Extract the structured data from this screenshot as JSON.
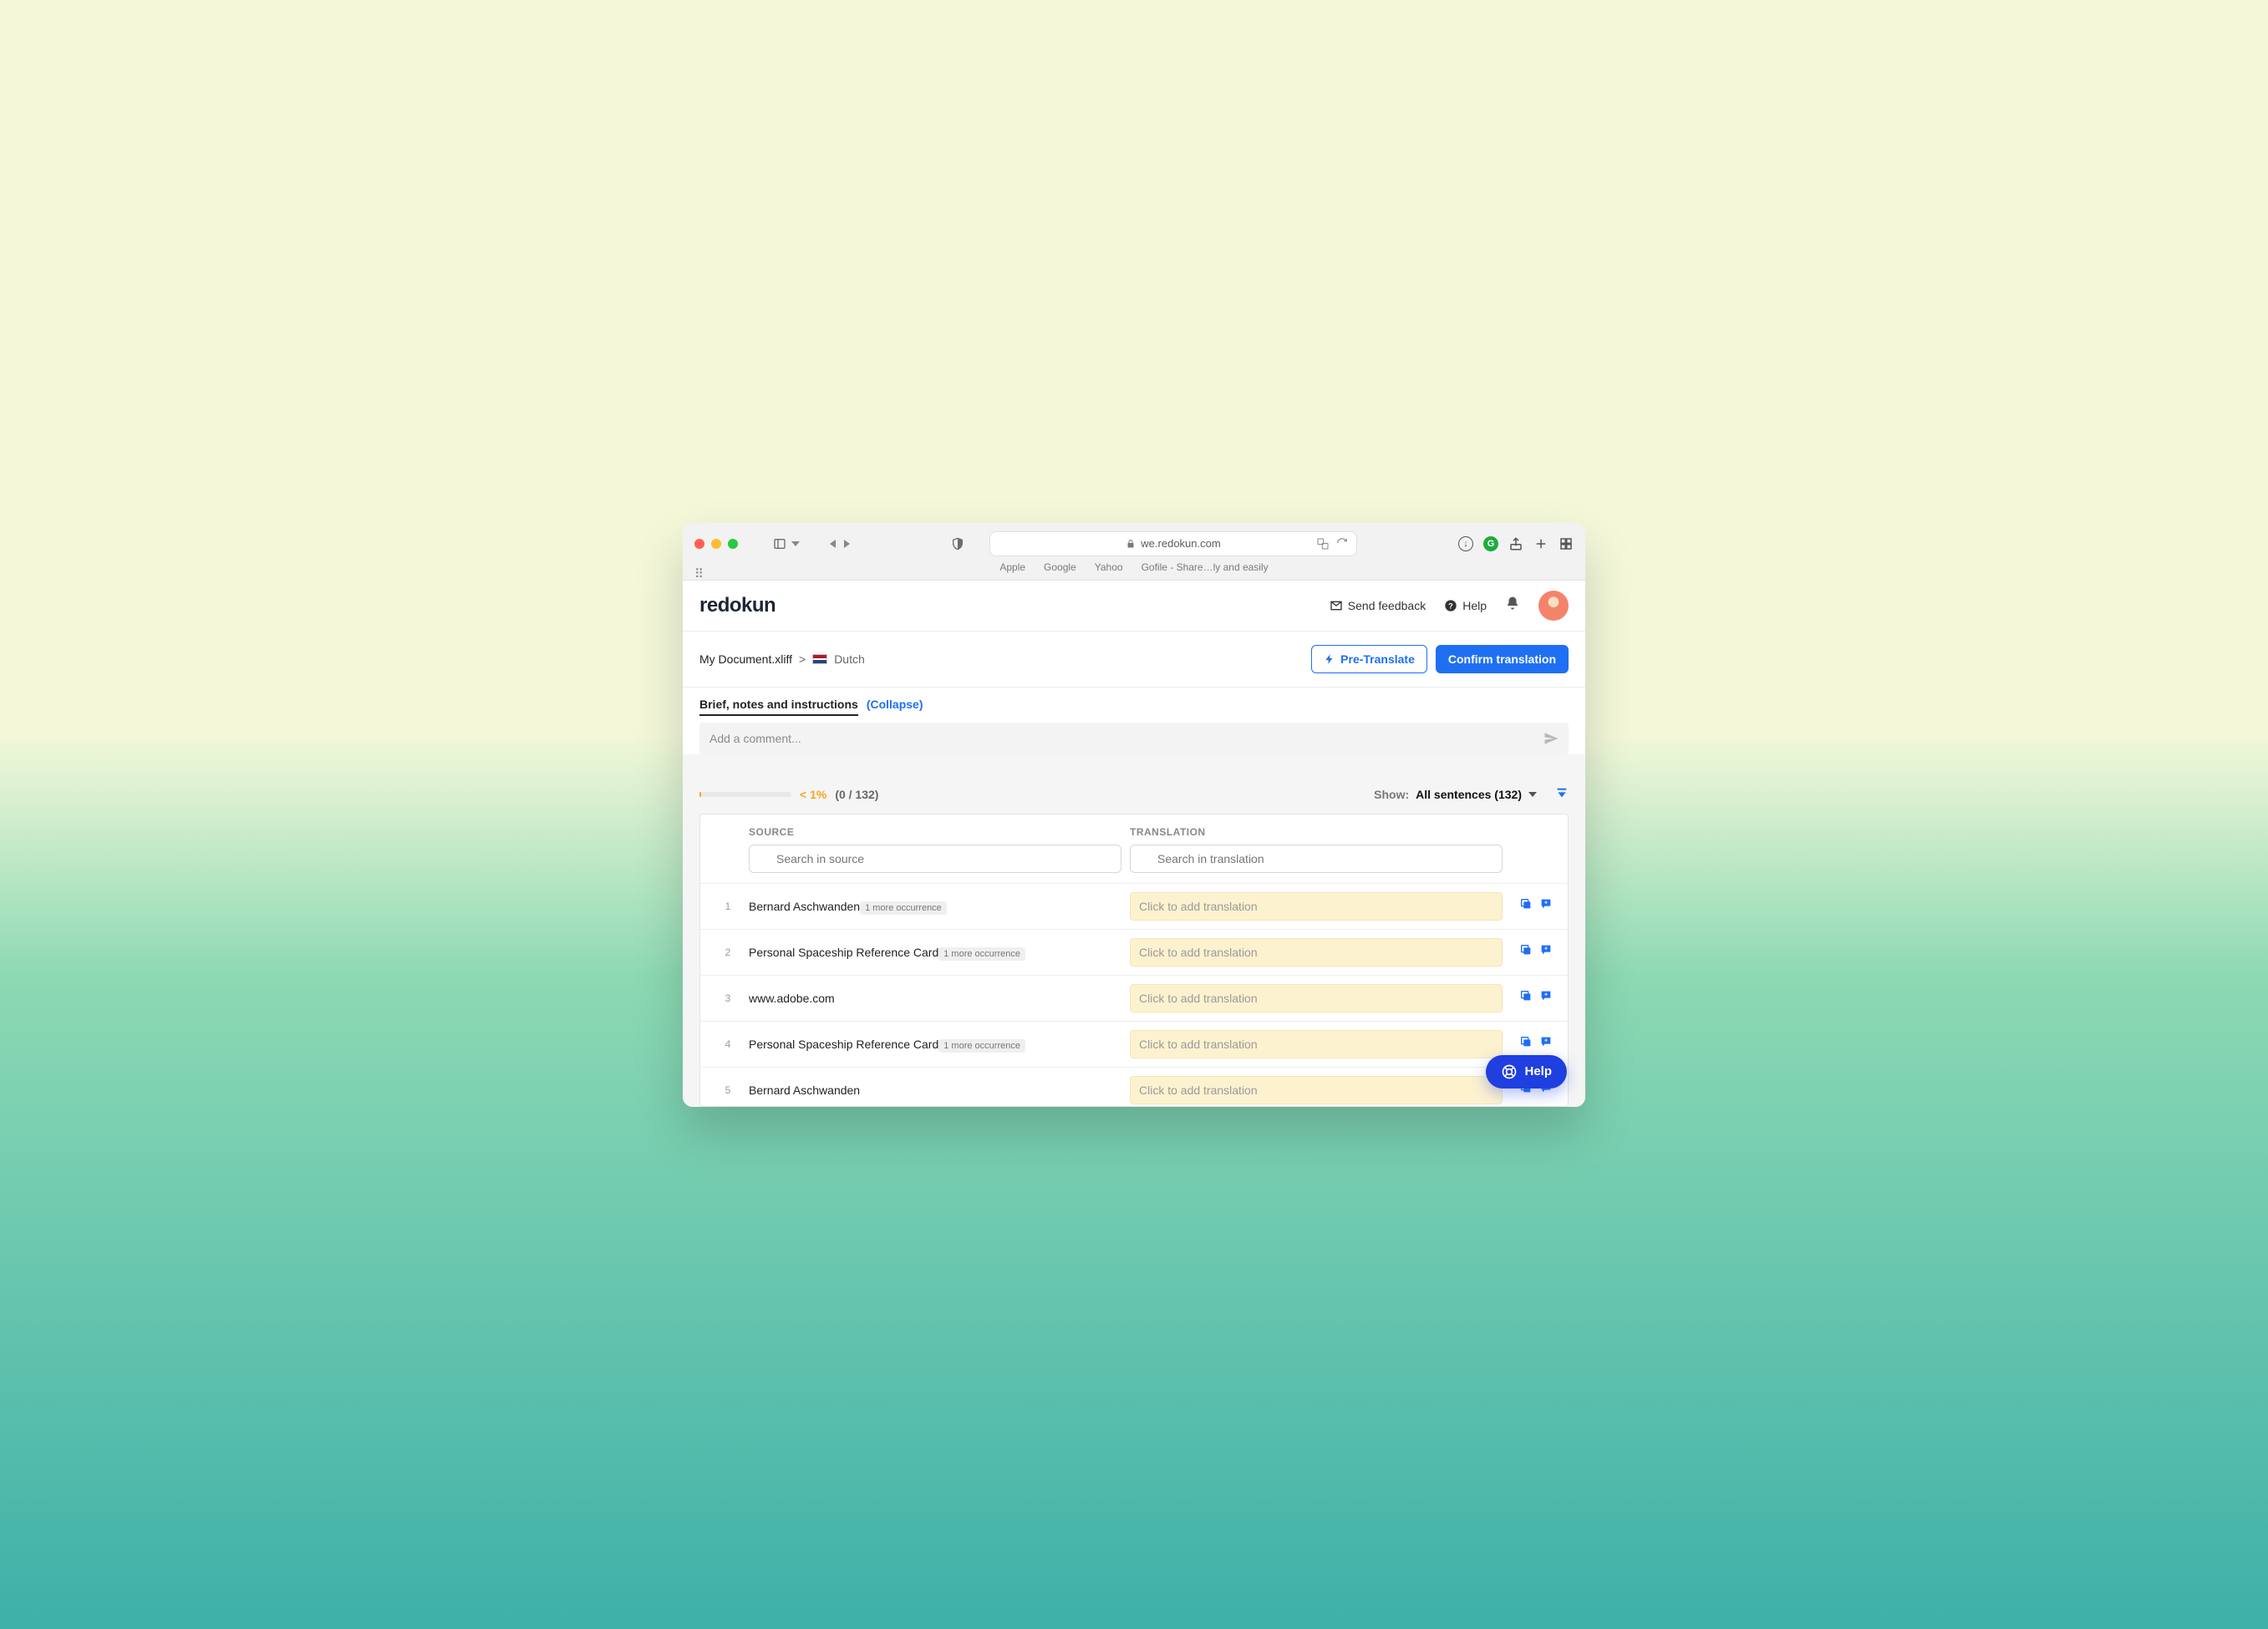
{
  "chrome": {
    "url": "we.redokun.com",
    "favorites": [
      "Apple",
      "Google",
      "Yahoo",
      "Gofile - Share…ly and easily"
    ]
  },
  "topbar": {
    "logo": "redokun",
    "feedback": "Send feedback",
    "help": "Help"
  },
  "subbar": {
    "doc": "My Document.xliff",
    "sep": ">",
    "lang": "Dutch",
    "pretranslate": "Pre-Translate",
    "confirm": "Confirm translation"
  },
  "brief": {
    "label": "Brief, notes and instructions",
    "collapse": "(Collapse)",
    "placeholder": "Add a comment..."
  },
  "progress": {
    "pct": "< 1%",
    "counts": "(0 / 132)"
  },
  "filter": {
    "show": "Show:",
    "value": "All sentences (132)"
  },
  "headers": {
    "source": "SOURCE",
    "translation": "TRANSLATION",
    "source_ph": "Search in source",
    "translation_ph": "Search in translation"
  },
  "rows": [
    {
      "n": "1",
      "src": "Bernard Aschwanden",
      "badge": "1 more occurrence",
      "t": "Click to add translation"
    },
    {
      "n": "2",
      "src": "Personal Spaceship Reference Card",
      "badge": "1 more occurrence",
      "t": "Click to add translation"
    },
    {
      "n": "3",
      "src": "www.adobe.com",
      "badge": "",
      "t": "Click to add translation"
    },
    {
      "n": "4",
      "src": "Personal Spaceship Reference Card",
      "badge": "1 more occurrence",
      "t": "Click to add translation"
    },
    {
      "n": "5",
      "src": "Bernard Aschwanden",
      "badge": "",
      "t": "Click to add translation"
    }
  ],
  "help_fab": "Help"
}
